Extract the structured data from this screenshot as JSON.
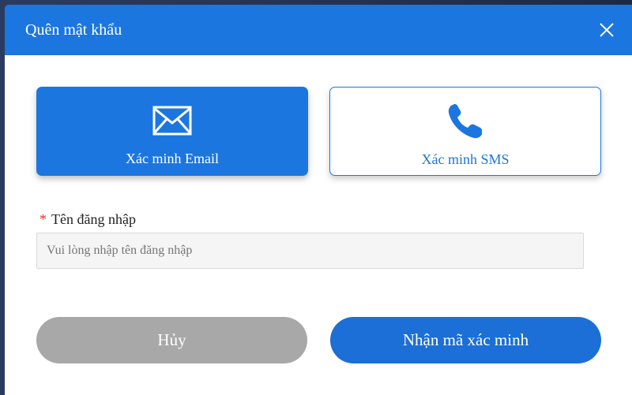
{
  "dialog": {
    "title": "Quên mật khẩu"
  },
  "methods": {
    "email": {
      "label": "Xác minh Email",
      "icon": "envelope-icon"
    },
    "sms": {
      "label": "Xác minh SMS",
      "icon": "phone-icon"
    }
  },
  "form": {
    "username": {
      "required_mark": "*",
      "label": "Tên đăng nhập",
      "placeholder": "Vui lòng nhập tên đăng nhập",
      "value": ""
    }
  },
  "actions": {
    "cancel_label": "Hủy",
    "submit_label": "Nhận mã xác minh"
  },
  "colors": {
    "primary": "#1b76e0",
    "cancel": "#a8a8a8",
    "required": "#e0302a"
  }
}
